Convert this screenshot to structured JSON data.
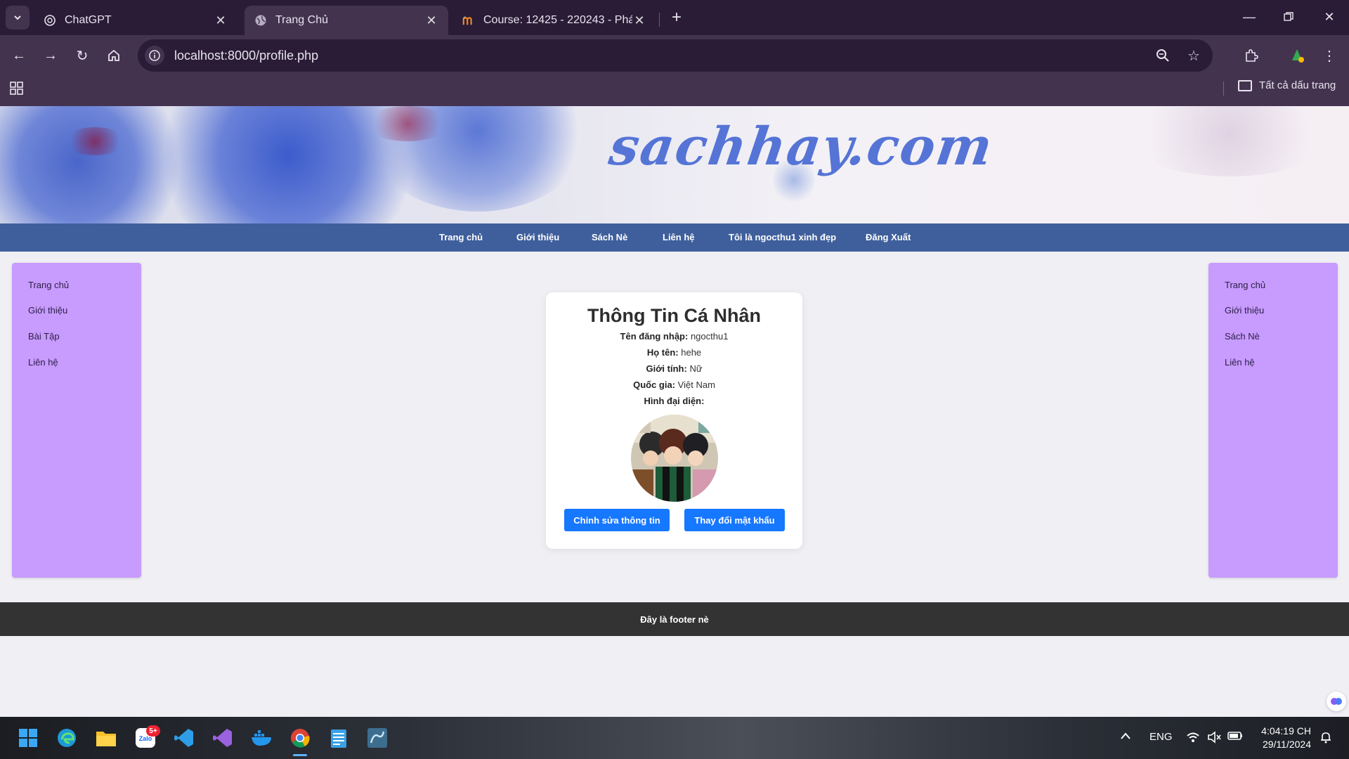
{
  "browser": {
    "tabs": [
      {
        "title": "ChatGPT",
        "icon": "chatgpt-icon",
        "active": false
      },
      {
        "title": "Trang Chủ",
        "icon": "globe-icon",
        "active": true
      },
      {
        "title": "Course: 12425 - 220243 - Phát t",
        "icon": "moodle-icon",
        "active": false
      }
    ],
    "url": "localhost:8000/profile.php",
    "bookmarks_all_label": "Tất cả dấu trang"
  },
  "site": {
    "logo_text": "sachhay.com",
    "nav": [
      "Trang chủ",
      "Giới thiệu",
      "Sách Nè",
      "Liên hệ",
      "Tôi là ngocthu1 xinh đẹp",
      "Đăng Xuất"
    ],
    "left_sidebar": [
      "Trang chủ",
      "Giới thiệu",
      "Bài Tập",
      "Liên hệ"
    ],
    "right_sidebar": [
      "Trang chủ",
      "Giới thiệu",
      "Sách Nè",
      "Liên hệ"
    ],
    "profile": {
      "title": "Thông Tin Cá Nhân",
      "fields": [
        {
          "label": "Tên đăng nhập:",
          "value": "ngocthu1"
        },
        {
          "label": "Họ tên:",
          "value": "hehe"
        },
        {
          "label": "Giới tính:",
          "value": "Nữ"
        },
        {
          "label": "Quốc gia:",
          "value": "Việt Nam"
        },
        {
          "label": "Hình đại diện:",
          "value": ""
        }
      ],
      "edit_button": "Chỉnh sửa thông tin",
      "password_button": "Thay đổi mật khẩu"
    },
    "footer": "Đây là footer nè"
  },
  "taskbar": {
    "zalo_badge": "5+",
    "language": "ENG",
    "time": "4:04:19 CH",
    "date": "29/11/2024"
  },
  "colors": {
    "nav_bg": "#3f5f9c",
    "sidebar_bg": "#c89bff",
    "button_bg": "#1677ff",
    "footer_bg": "#333333"
  }
}
